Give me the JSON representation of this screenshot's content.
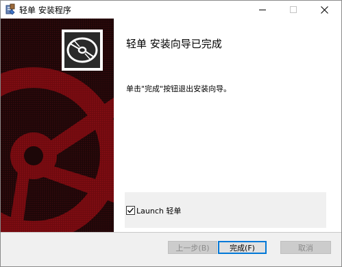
{
  "titlebar": {
    "title": "轻单 安装程序",
    "icon": "installer-app-icon",
    "minimize_icon": "minimize-icon",
    "maximize_icon": "maximize-icon",
    "close_icon": "close-icon"
  },
  "banner": {
    "logo_icon": "disc-icon",
    "colors": {
      "background": "#1c0708",
      "accent": "#7a0b10"
    }
  },
  "content": {
    "heading": "轻单 安装向导已完成",
    "description": "单击\"完成\"按钮退出安装向导。",
    "launch_checkbox": {
      "label": "Launch 轻单",
      "checked": true
    }
  },
  "buttons": {
    "back": {
      "label": "上一步(B)",
      "enabled": false
    },
    "finish": {
      "label": "完成(F)",
      "enabled": true,
      "default": true
    },
    "cancel": {
      "label": "取消",
      "enabled": false
    }
  },
  "colors": {
    "focus_border": "#0078d7",
    "disabled_text": "#8a8a8a"
  }
}
